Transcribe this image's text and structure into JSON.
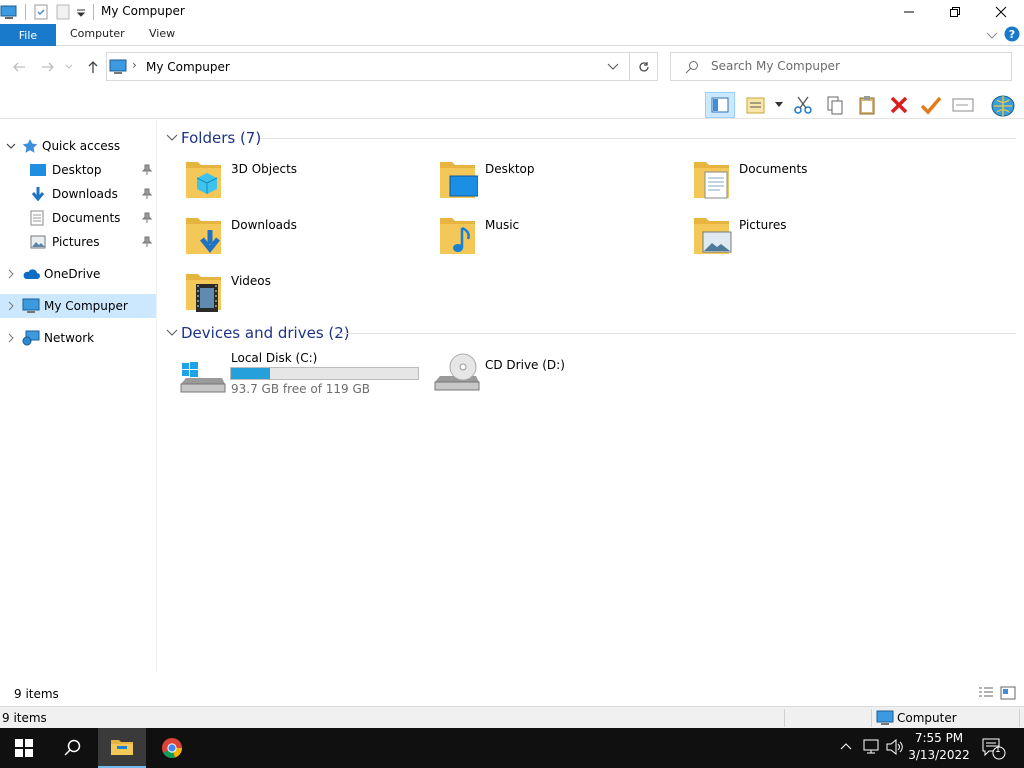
{
  "window": {
    "title": "My Compuper"
  },
  "ribbon": {
    "tabs": [
      "File",
      "Computer",
      "View"
    ]
  },
  "address": {
    "path": "My Compuper"
  },
  "search": {
    "placeholder": "Search My Compuper"
  },
  "nav": {
    "quick_access": "Quick access",
    "pinned": [
      "Desktop",
      "Downloads",
      "Documents",
      "Pictures"
    ],
    "onedrive": "OneDrive",
    "this_pc": "My Compuper",
    "network": "Network"
  },
  "folders": {
    "header": "Folders (7)",
    "items": [
      "3D Objects",
      "Desktop",
      "Documents",
      "Downloads",
      "Music",
      "Pictures",
      "Videos"
    ]
  },
  "drives": {
    "header": "Devices and drives (2)",
    "items": [
      {
        "name": "Local Disk (C:)",
        "free": "93.7 GB free of 119 GB",
        "used_fraction": 0.21
      },
      {
        "name": "CD Drive (D:)"
      }
    ]
  },
  "status": {
    "items_count": "9 items",
    "bottom_count": "9 items",
    "location": "Computer"
  },
  "taskbar": {
    "time": "7:55 PM",
    "date": "3/13/2022",
    "notification_count": "1"
  },
  "colors": {
    "accent": "#1979ca",
    "folder": "#f3c859",
    "selection": "#cce8ff",
    "drive_fill": "#26a0da",
    "header": "#1e3287"
  }
}
